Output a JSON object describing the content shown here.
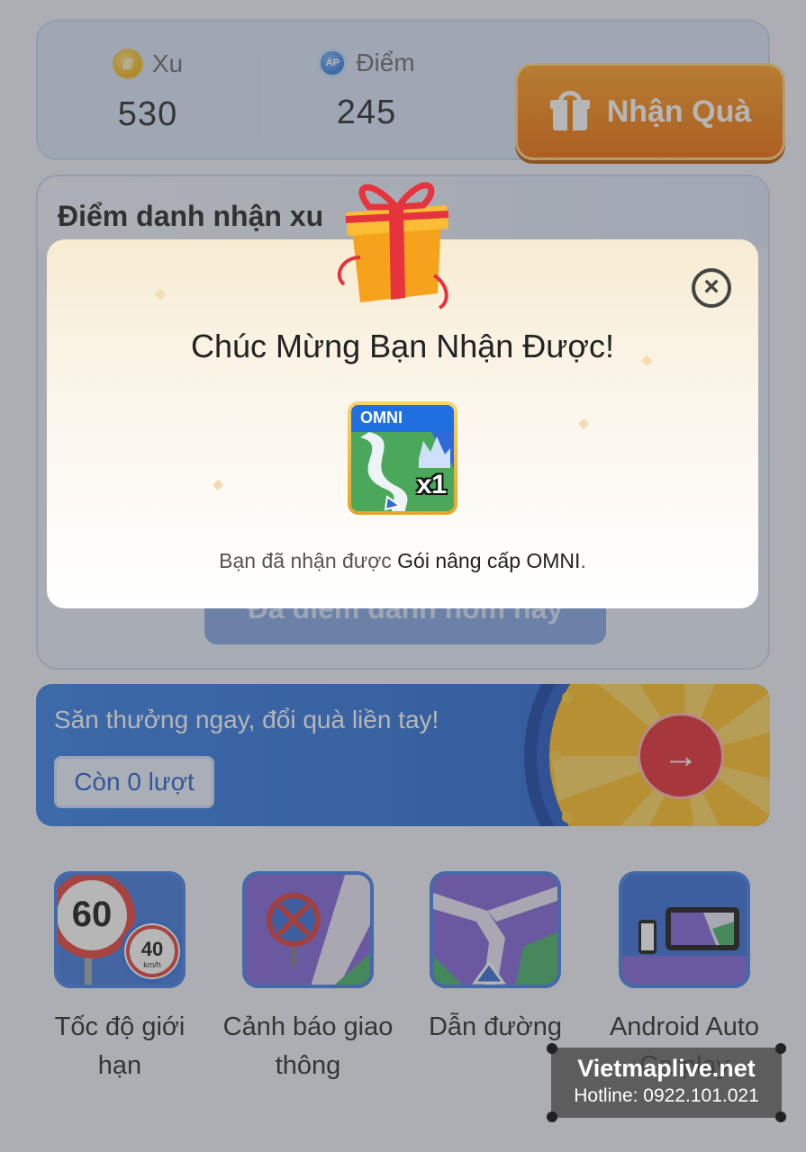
{
  "stats": {
    "xu_label": "Xu",
    "xu_value": "530",
    "diem_label": "Điểm",
    "diem_value": "245",
    "ap_badge": "AP",
    "gift_button_label": "Nhận Quà"
  },
  "checkin": {
    "title": "Điểm danh nhận xu",
    "button_label": "Đã điểm danh hôm nay"
  },
  "wheel": {
    "promo_text": "Săn thưởng ngay, đổi quà liền tay!",
    "turns_label": "Còn 0 lượt",
    "go_icon": "arrow-right-icon"
  },
  "features": [
    {
      "label": "Tốc độ giới hạn",
      "sign_main": "60",
      "sign_small": "40",
      "sign_unit": "km/h"
    },
    {
      "label": "Cảnh báo giao thông"
    },
    {
      "label": "Dẫn đường"
    },
    {
      "label": "Android Auto Carplay"
    }
  ],
  "modal": {
    "title": "Chúc Mừng Bạn Nhận Được!",
    "reward_name": "OMNI",
    "reward_qty": "x1",
    "desc_prefix": "Bạn đã nhận được",
    "desc_highlight": "Gói nâng cấp OMNI",
    "desc_suffix": "."
  },
  "watermark": {
    "site": "Vietmaplive.net",
    "hotline": "Hotline: 0922.101.021"
  },
  "colors": {
    "accent_blue": "#2f7be7",
    "gift_orange": "#f06a00",
    "wheel_red": "#e4272f"
  }
}
